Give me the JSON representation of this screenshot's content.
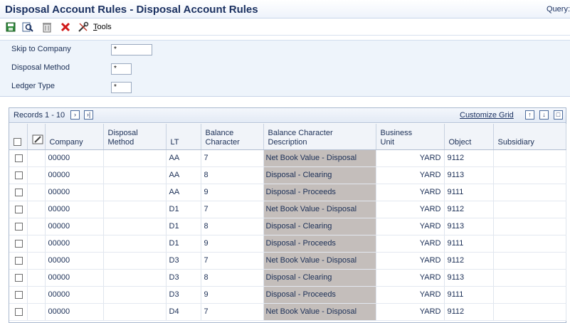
{
  "window": {
    "title": "Disposal Account Rules - Disposal Account Rules",
    "query_label": "Query:"
  },
  "toolbar": {
    "tools_label_first": "T",
    "tools_label_rest": "ools"
  },
  "filters": {
    "skip_to_company": {
      "label": "Skip to Company",
      "value": "*"
    },
    "disposal_method": {
      "label": "Disposal Method",
      "value": "*"
    },
    "ledger_type": {
      "label": "Ledger Type",
      "value": "*"
    }
  },
  "grid": {
    "records_label": "Records 1 - 10",
    "customize_label": "Customize Grid",
    "columns": {
      "company": "Company",
      "disposal_method": "Disposal\nMethod",
      "lt": "LT",
      "balance_character": "Balance\nCharacter",
      "bc_description": "Balance Character\nDescription",
      "business_unit": "Business\nUnit",
      "object": "Object",
      "subsidiary": "Subsidiary"
    },
    "rows": [
      {
        "company": "00000",
        "method": "",
        "lt": "AA",
        "bc": "7",
        "desc": "Net Book Value - Disposal",
        "bu": "YARD",
        "object": "9112",
        "sub": ""
      },
      {
        "company": "00000",
        "method": "",
        "lt": "AA",
        "bc": "8",
        "desc": "Disposal - Clearing",
        "bu": "YARD",
        "object": "9113",
        "sub": ""
      },
      {
        "company": "00000",
        "method": "",
        "lt": "AA",
        "bc": "9",
        "desc": "Disposal - Proceeds",
        "bu": "YARD",
        "object": "9111",
        "sub": ""
      },
      {
        "company": "00000",
        "method": "",
        "lt": "D1",
        "bc": "7",
        "desc": "Net Book Value - Disposal",
        "bu": "YARD",
        "object": "9112",
        "sub": ""
      },
      {
        "company": "00000",
        "method": "",
        "lt": "D1",
        "bc": "8",
        "desc": "Disposal - Clearing",
        "bu": "YARD",
        "object": "9113",
        "sub": ""
      },
      {
        "company": "00000",
        "method": "",
        "lt": "D1",
        "bc": "9",
        "desc": "Disposal - Proceeds",
        "bu": "YARD",
        "object": "9111",
        "sub": ""
      },
      {
        "company": "00000",
        "method": "",
        "lt": "D3",
        "bc": "7",
        "desc": "Net Book Value - Disposal",
        "bu": "YARD",
        "object": "9112",
        "sub": ""
      },
      {
        "company": "00000",
        "method": "",
        "lt": "D3",
        "bc": "8",
        "desc": "Disposal - Clearing",
        "bu": "YARD",
        "object": "9113",
        "sub": ""
      },
      {
        "company": "00000",
        "method": "",
        "lt": "D3",
        "bc": "9",
        "desc": "Disposal - Proceeds",
        "bu": "YARD",
        "object": "9111",
        "sub": ""
      },
      {
        "company": "00000",
        "method": "",
        "lt": "D4",
        "bc": "7",
        "desc": "Net Book Value - Disposal",
        "bu": "YARD",
        "object": "9112",
        "sub": ""
      }
    ]
  },
  "icons": {
    "save": "save-icon",
    "find": "find-icon",
    "delete": "trash-icon",
    "cancel": "close-icon",
    "tools": "tools-icon",
    "next": "next-page-icon",
    "last": "last-page-icon",
    "export": "export-icon",
    "import": "import-icon",
    "maximize": "maximize-icon",
    "edit": "edit-icon"
  },
  "colors": {
    "title": "#1b3161",
    "filter_bg": "#eef4fb",
    "description_bg": "#c4bebb",
    "cancel_red": "#d11a1a"
  }
}
